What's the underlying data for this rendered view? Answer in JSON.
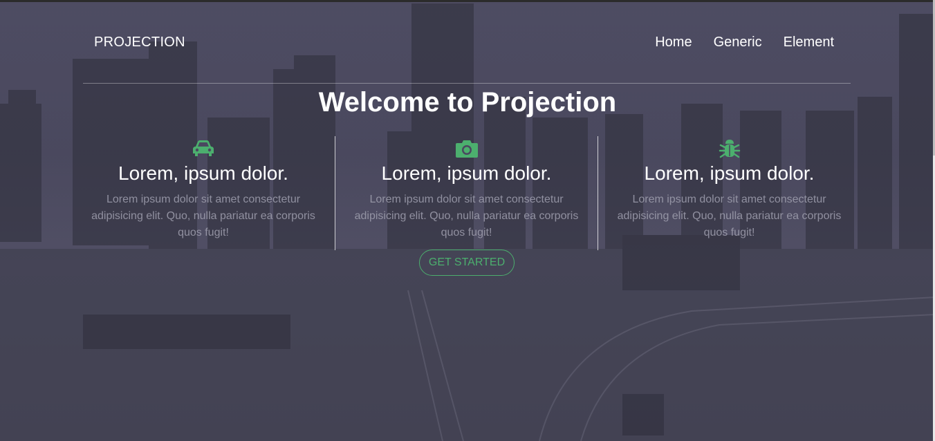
{
  "header": {
    "brand": "PROJECTION",
    "nav": [
      {
        "label": "Home"
      },
      {
        "label": "Generic"
      },
      {
        "label": "Element"
      }
    ]
  },
  "hero": {
    "title": "Welcome to Projection",
    "cta_label": "GET STARTED"
  },
  "features": [
    {
      "icon": "car-icon",
      "heading": "Lorem, ipsum dolor.",
      "text": "Lorem ipsum dolor sit amet consectetur adipisicing elit. Quo, nulla pariatur ea corporis quos fugit!"
    },
    {
      "icon": "camera-icon",
      "heading": "Lorem, ipsum dolor.",
      "text": "Lorem ipsum dolor sit amet consectetur adipisicing elit. Quo, nulla pariatur ea corporis quos fugit!"
    },
    {
      "icon": "bug-icon",
      "heading": "Lorem, ipsum dolor.",
      "text": "Lorem ipsum dolor sit amet consectetur adipisicing elit. Quo, nulla pariatur ea corporis quos fugit!"
    }
  ],
  "colors": {
    "accent": "#4caf6e",
    "overlay": "#4a4860"
  }
}
